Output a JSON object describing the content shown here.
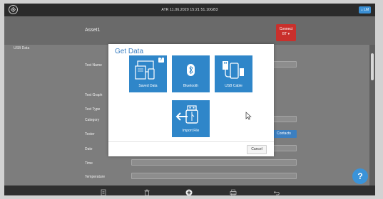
{
  "status_bar": {
    "datetime": "ATR 11.06.2020 15:21 51.10GB3",
    "user_badge": "⌂ LM"
  },
  "header": {
    "asset_title": "Asset1",
    "connect_label": "Connect",
    "connect_sub": "BT ▾"
  },
  "content": {
    "section_label": "USB Data",
    "fields": [
      {
        "label": "Test Name"
      },
      {
        "label": "Test Graph"
      },
      {
        "label": "Test Type"
      },
      {
        "label": "Category"
      },
      {
        "label": "Tester"
      },
      {
        "label": "Date"
      },
      {
        "label": "Time"
      },
      {
        "label": "Temperature"
      }
    ],
    "contacts_label": "Contacts"
  },
  "modal": {
    "title": "Get Data",
    "tiles": [
      {
        "label": "Saved Data",
        "icon": "saved-data-icon",
        "badge": "7"
      },
      {
        "label": "Bluetooth",
        "icon": "bluetooth-icon"
      },
      {
        "label": "USB Cable",
        "icon": "usb-cable-icon"
      },
      {
        "label": "Import File",
        "icon": "import-file-icon"
      }
    ],
    "cancel_label": "Cancel"
  },
  "help_label": "?",
  "bottom_bar": {
    "icons": [
      "document-icon",
      "trash-icon",
      "add-icon",
      "print-icon",
      "back-icon"
    ]
  },
  "colors": {
    "accent": "#2f86c9",
    "title": "#3b7fc2",
    "connect": "#c9302c",
    "help": "#3a93d9"
  }
}
